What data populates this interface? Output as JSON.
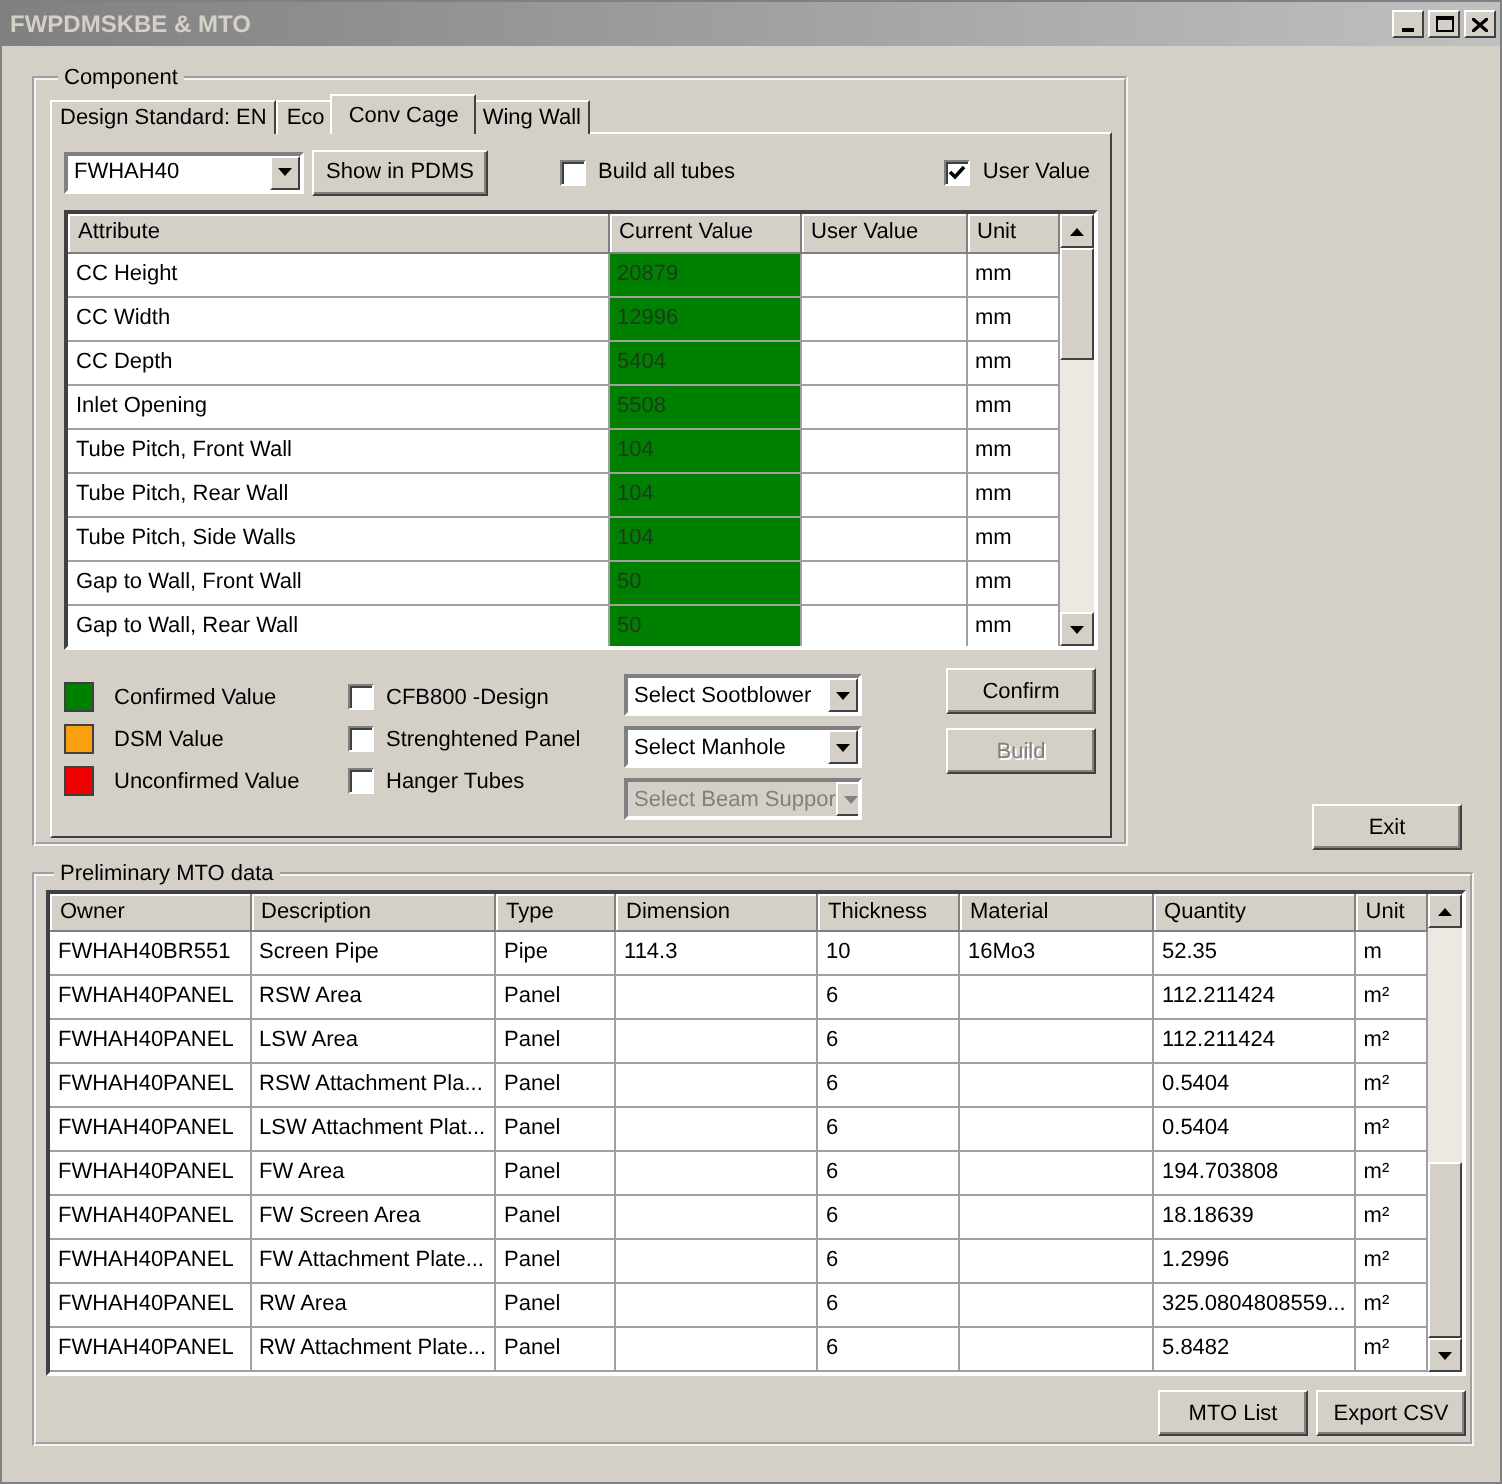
{
  "window": {
    "title": "FWPDMSKBE & MTO"
  },
  "component": {
    "title": "Component",
    "tabs": [
      {
        "label": "Design Standard: EN",
        "selected": false
      },
      {
        "label": "Eco",
        "selected": false
      },
      {
        "label": "Conv Cage",
        "selected": true
      },
      {
        "label": "Wing Wall",
        "selected": false
      }
    ],
    "selector": {
      "value": "FWHAH40"
    },
    "show_button": "Show in PDMS",
    "build_all": {
      "label": "Build all tubes",
      "checked": false
    },
    "user_value": {
      "label": "User Value",
      "checked": true
    },
    "columns": [
      "Attribute",
      "Current Value",
      "User Value",
      "Unit"
    ],
    "rows": [
      {
        "attribute": "CC Height",
        "current": "20879",
        "unit": "mm",
        "color": "#008000"
      },
      {
        "attribute": "CC Width",
        "current": "12996",
        "unit": "mm",
        "color": "#008000"
      },
      {
        "attribute": "CC Depth",
        "current": "5404",
        "unit": "mm",
        "color": "#008000"
      },
      {
        "attribute": "Inlet Opening",
        "current": "5508",
        "unit": "mm",
        "color": "#008000"
      },
      {
        "attribute": "Tube Pitch, Front Wall",
        "current": "104",
        "unit": "mm",
        "color": "#008000"
      },
      {
        "attribute": "Tube Pitch, Rear Wall",
        "current": "104",
        "unit": "mm",
        "color": "#008000"
      },
      {
        "attribute": "Tube Pitch, Side Walls",
        "current": "104",
        "unit": "mm",
        "color": "#008000"
      },
      {
        "attribute": "Gap to Wall, Front Wall",
        "current": "50",
        "unit": "mm",
        "color": "#008000"
      },
      {
        "attribute": "Gap to Wall, Rear Wall",
        "current": "50",
        "unit": "mm",
        "color": "#008000"
      }
    ],
    "legend": [
      {
        "label": "Confirmed Value",
        "color": "#008000"
      },
      {
        "label": "DSM Value",
        "color": "#f8a010"
      },
      {
        "label": "Unconfirmed Value",
        "color": "#f00000"
      }
    ],
    "options": [
      {
        "label": "CFB800 -Design",
        "checked": false
      },
      {
        "label": "Strenghtened Panel",
        "checked": false
      },
      {
        "label": "Hanger Tubes",
        "checked": false
      }
    ],
    "dropdowns": [
      {
        "value": "Select Sootblower",
        "disabled": false
      },
      {
        "value": "Select Manhole",
        "disabled": false
      },
      {
        "value": "Select Beam Suppor",
        "disabled": true
      }
    ],
    "buttons": [
      {
        "label": "Confirm",
        "disabled": false
      },
      {
        "label": "Build",
        "disabled": true
      }
    ]
  },
  "exit_button": "Exit",
  "mto": {
    "title": "Preliminary MTO data",
    "columns": [
      "Owner",
      "Description",
      "Type",
      "Dimension",
      "Thickness",
      "Material",
      "Quantity",
      "Unit"
    ],
    "rows": [
      [
        "FWHAH40BR551",
        "Screen Pipe",
        "Pipe",
        "114.3",
        "10",
        "16Mo3",
        "52.35",
        "m"
      ],
      [
        "FWHAH40PANEL",
        "RSW Area",
        "Panel",
        "",
        "6",
        "",
        "112.211424",
        "m²"
      ],
      [
        "FWHAH40PANEL",
        "LSW Area",
        "Panel",
        "",
        "6",
        "",
        "112.211424",
        "m²"
      ],
      [
        "FWHAH40PANEL",
        "RSW Attachment Pla...",
        "Panel",
        "",
        "6",
        "",
        "0.5404",
        "m²"
      ],
      [
        "FWHAH40PANEL",
        "LSW Attachment Plat...",
        "Panel",
        "",
        "6",
        "",
        "0.5404",
        "m²"
      ],
      [
        "FWHAH40PANEL",
        "FW Area",
        "Panel",
        "",
        "6",
        "",
        "194.703808",
        "m²"
      ],
      [
        "FWHAH40PANEL",
        "FW Screen Area",
        "Panel",
        "",
        "6",
        "",
        "18.18639",
        "m²"
      ],
      [
        "FWHAH40PANEL",
        "FW Attachment Plate...",
        "Panel",
        "",
        "6",
        "",
        "1.2996",
        "m²"
      ],
      [
        "FWHAH40PANEL",
        "RW Area",
        "Panel",
        "",
        "6",
        "",
        "325.0804808559...",
        "m²"
      ],
      [
        "FWHAH40PANEL",
        "RW Attachment Plate...",
        "Panel",
        "",
        "6",
        "",
        "5.8482",
        "m²"
      ]
    ],
    "buttons": [
      "MTO List",
      "Export CSV"
    ]
  }
}
